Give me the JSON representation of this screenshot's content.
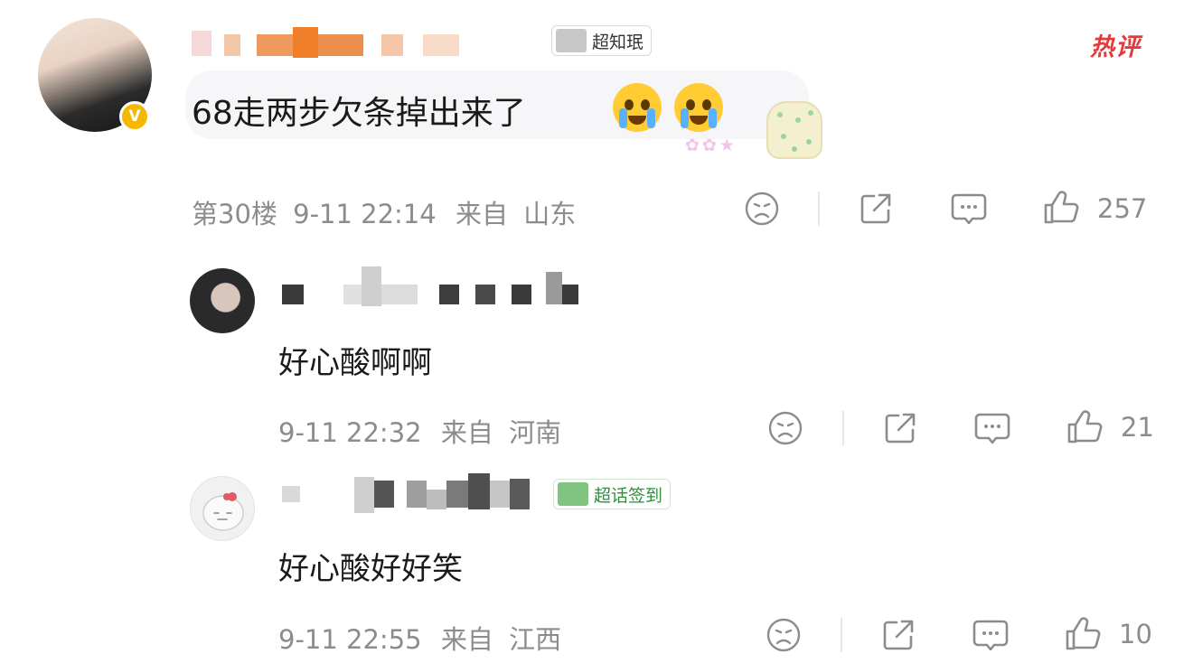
{
  "hot_label": "热评",
  "main_comment": {
    "user_tag": "超知珉",
    "text": "68走两步欠条掉出来了",
    "floor": "第30楼",
    "time": "9-11 22:14",
    "from_label": "来自",
    "location": "山东",
    "likes": "257",
    "verified_icon": "v-badge-icon"
  },
  "replies": [
    {
      "text": "好心酸啊啊",
      "time": "9-11 22:32",
      "from_label": "来自",
      "location": "河南",
      "likes": "21"
    },
    {
      "user_tag": "超话签到",
      "text": "好心酸好好笑",
      "time": "9-11 22:55",
      "from_label": "来自",
      "location": "江西",
      "likes": "10"
    }
  ],
  "colors": {
    "hot": "#e33b3b",
    "meta": "#8c8c8c",
    "badge": "#f5b800"
  }
}
